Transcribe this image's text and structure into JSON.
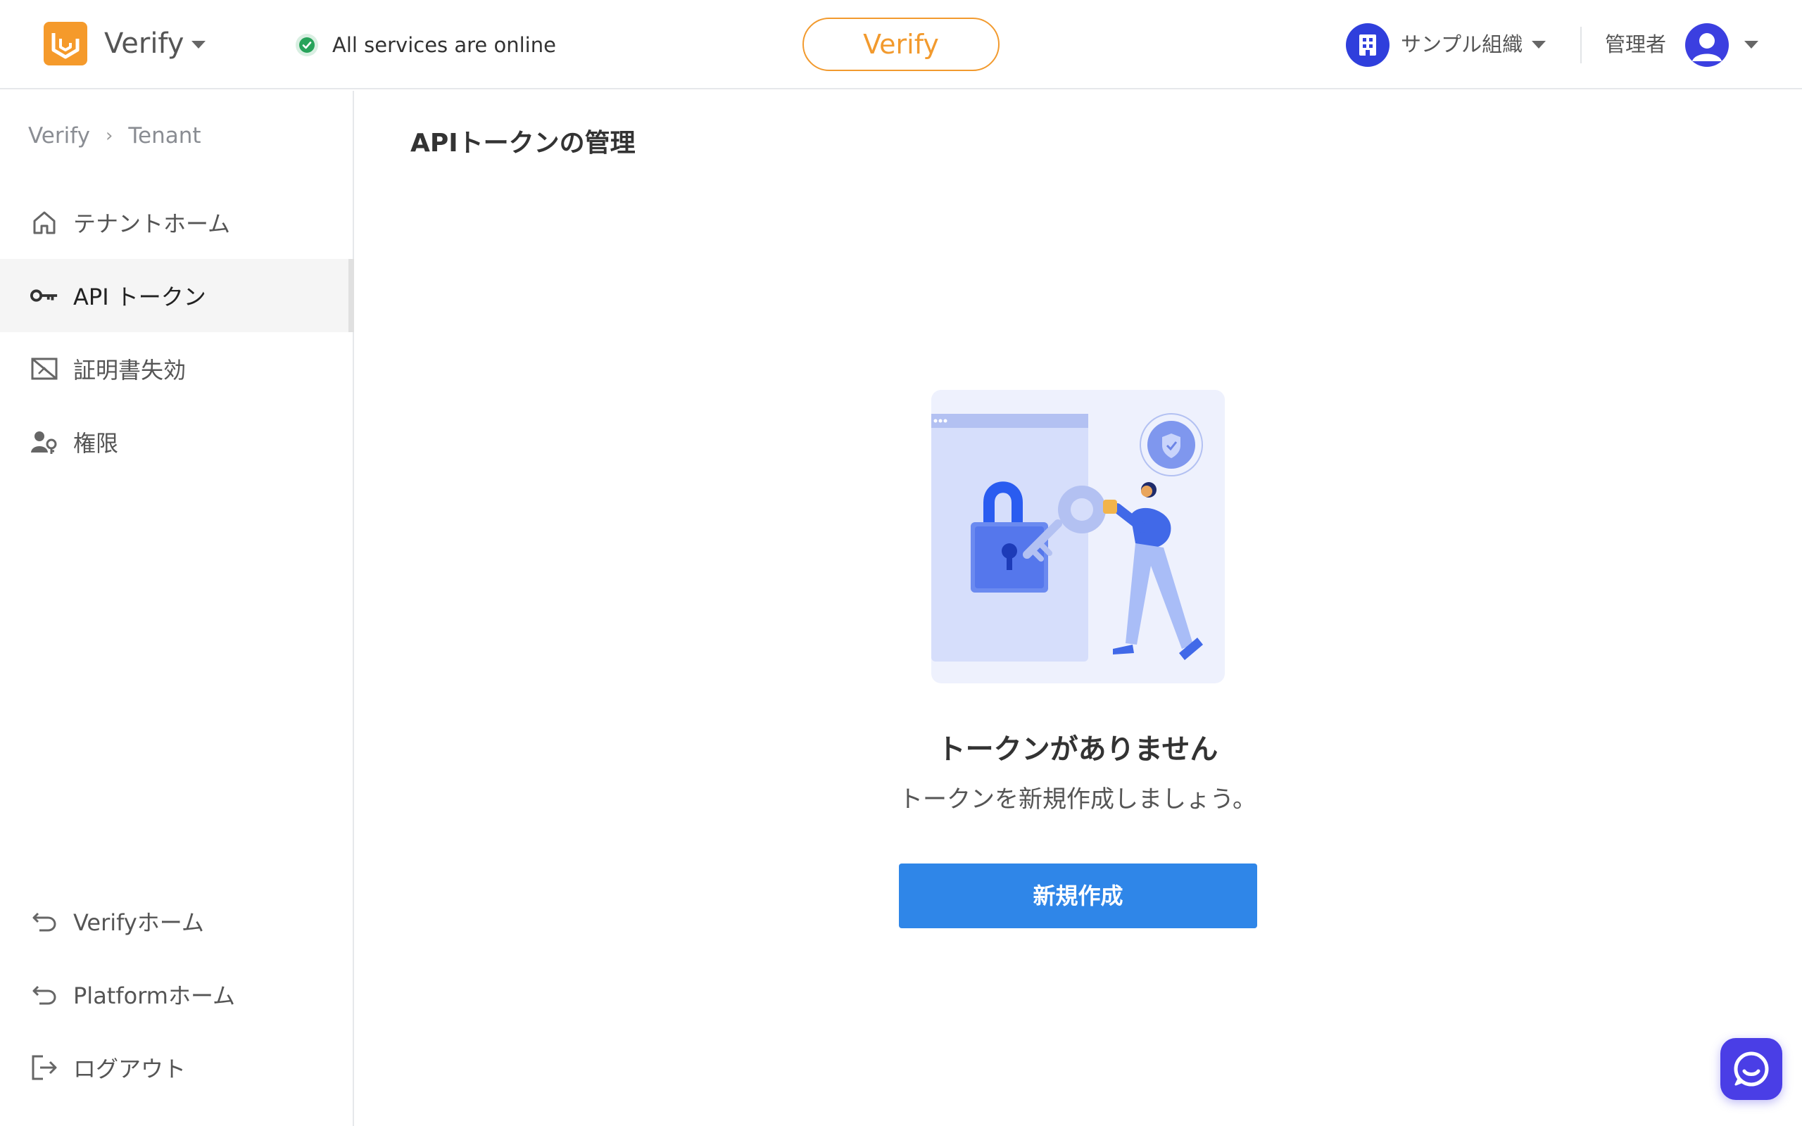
{
  "header": {
    "app_name": "Verify",
    "status_text": "All services are online",
    "center_label": "Verify",
    "org_name": "サンプル組織",
    "role": "管理者"
  },
  "breadcrumb": {
    "items": [
      "Verify",
      "Tenant"
    ]
  },
  "sidebar": {
    "items": [
      {
        "label": "テナントホーム",
        "icon": "home-icon"
      },
      {
        "label": "API トークン",
        "icon": "key-icon",
        "active": true
      },
      {
        "label": "証明書失効",
        "icon": "certificate-revoke-icon"
      },
      {
        "label": "権限",
        "icon": "user-permission-icon"
      }
    ],
    "bottom_items": [
      {
        "label": "Verifyホーム",
        "icon": "undo-arrow-icon"
      },
      {
        "label": "Platformホーム",
        "icon": "undo-arrow-icon"
      },
      {
        "label": "ログアウト",
        "icon": "logout-icon"
      }
    ]
  },
  "main": {
    "title": "APIトークンの管理",
    "empty_title": "トークンがありません",
    "empty_subtitle": "トークンを新規作成しましょう。",
    "create_button": "新規作成"
  },
  "colors": {
    "accent_orange": "#f29a2e",
    "primary_blue": "#2f86e8",
    "status_green": "#27a35a",
    "org_blue": "#2f3fdc",
    "chat_purple": "#4a3ee6"
  }
}
